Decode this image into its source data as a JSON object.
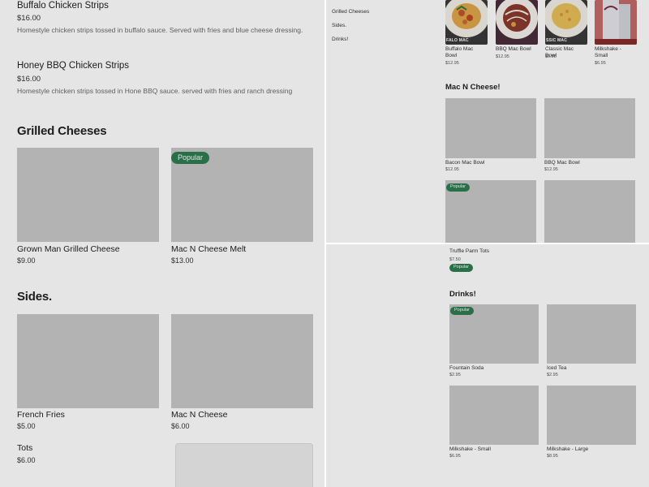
{
  "left": {
    "items": [
      {
        "name": "Buffalo Chicken Strips",
        "price": "$16.00",
        "desc": "Homestyle chicken strips tossed in buffalo sauce. Served with fries and blue cheese dressing."
      },
      {
        "name": "Honey BBQ Chicken Strips",
        "price": "$16.00",
        "desc": "Homestyle chicken strips tossed in Hone BBQ sauce. served with fries and ranch dressing"
      }
    ],
    "grilled": {
      "heading": "Grilled Cheeses",
      "cards": [
        {
          "name": "Grown Man Grilled Cheese",
          "price": "$9.00"
        },
        {
          "name": "Mac N Cheese Melt",
          "price": "$13.00",
          "badge": "Popular"
        }
      ]
    },
    "sides": {
      "heading": "Sides.",
      "cards": [
        {
          "name": "French Fries",
          "price": "$5.00"
        },
        {
          "name": "Mac N Cheese",
          "price": "$6.00"
        }
      ],
      "extra": {
        "name": "Tots",
        "price": "$6.00"
      }
    }
  },
  "top_right": {
    "nav": [
      "Grilled Cheeses",
      "Sides.",
      "Drinks!"
    ],
    "popular_row": [
      {
        "name": "Buffalo Mac Bowl",
        "price": "$12.95",
        "caption": "FALO MAC",
        "color": "#ffffff"
      },
      {
        "name": "BBQ Mac Bowl",
        "price": "$12.95",
        "caption": "",
        "color": "#4a2c3a"
      },
      {
        "name": "Classic Mac Bowl",
        "price": "$9.95",
        "caption": "SSIC MAC",
        "color": "#d9b24a"
      },
      {
        "name": "Milkshake - Small",
        "price": "$6.95",
        "caption": "",
        "color": "#c46a6a"
      }
    ],
    "mac_heading": "Mac N Cheese!",
    "mac_cards": [
      {
        "name": "Bacon Mac Bowl",
        "price": "$12.95"
      },
      {
        "name": "BBQ Mac Bowl",
        "price": "$12.95"
      }
    ],
    "badge": "Popular"
  },
  "bottom_right": {
    "top_item": {
      "name": "Truffle Parm Tots",
      "price": "$7.50",
      "badge": "Popular"
    },
    "drinks_heading": "Drinks!",
    "drinks": [
      {
        "name": "Fountain Soda",
        "price": "$2.95",
        "badge": "Popular"
      },
      {
        "name": "Iced Tea",
        "price": "$2.95"
      },
      {
        "name": "Milkshake - Small",
        "price": "$6.95"
      },
      {
        "name": "Milkshake - Large",
        "price": "$8.95"
      }
    ]
  }
}
